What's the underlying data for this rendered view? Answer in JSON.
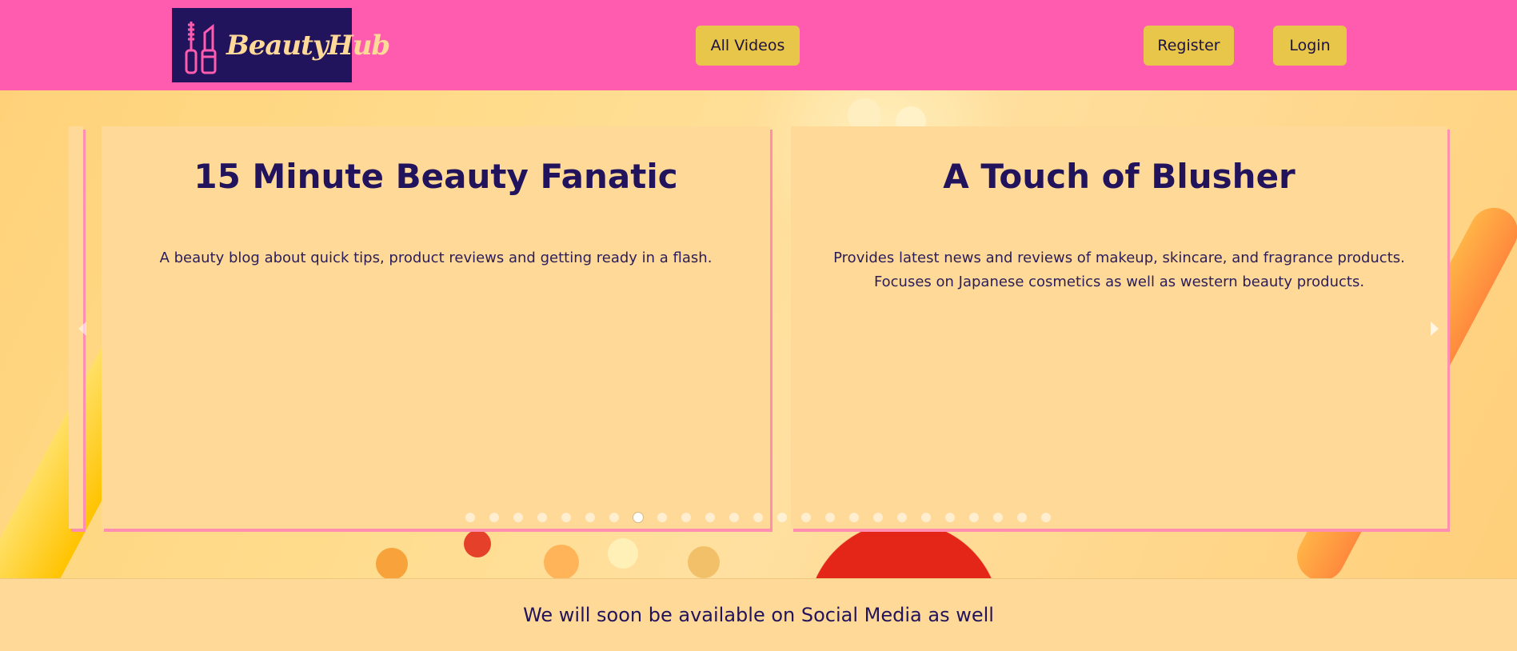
{
  "header": {
    "logo_text": "BeautyHub",
    "logo_icon": "makeup-brush-lipstick-icon",
    "nav": {
      "all_videos": "All Videos",
      "register": "Register",
      "login": "Login"
    }
  },
  "carousel": {
    "cards": [
      {
        "title": "15 Minute Beauty Fanatic",
        "description": "A beauty blog about quick tips, product reviews and getting ready in a flash."
      },
      {
        "title": "A Touch of Blusher",
        "description": "Provides latest news and reviews of makeup, skincare, and fragrance products. Focuses on Japanese cosmetics as well as western beauty products."
      }
    ],
    "dot_count": 25,
    "active_dot": 8
  },
  "footer": {
    "text": "We will soon be available on Social Media as well"
  },
  "colors": {
    "header_bg": "#ff5cb0",
    "logo_bg": "#21135c",
    "button_bg": "#e8c64a",
    "card_bg": "#ffd997",
    "text_dark": "#21135c"
  }
}
